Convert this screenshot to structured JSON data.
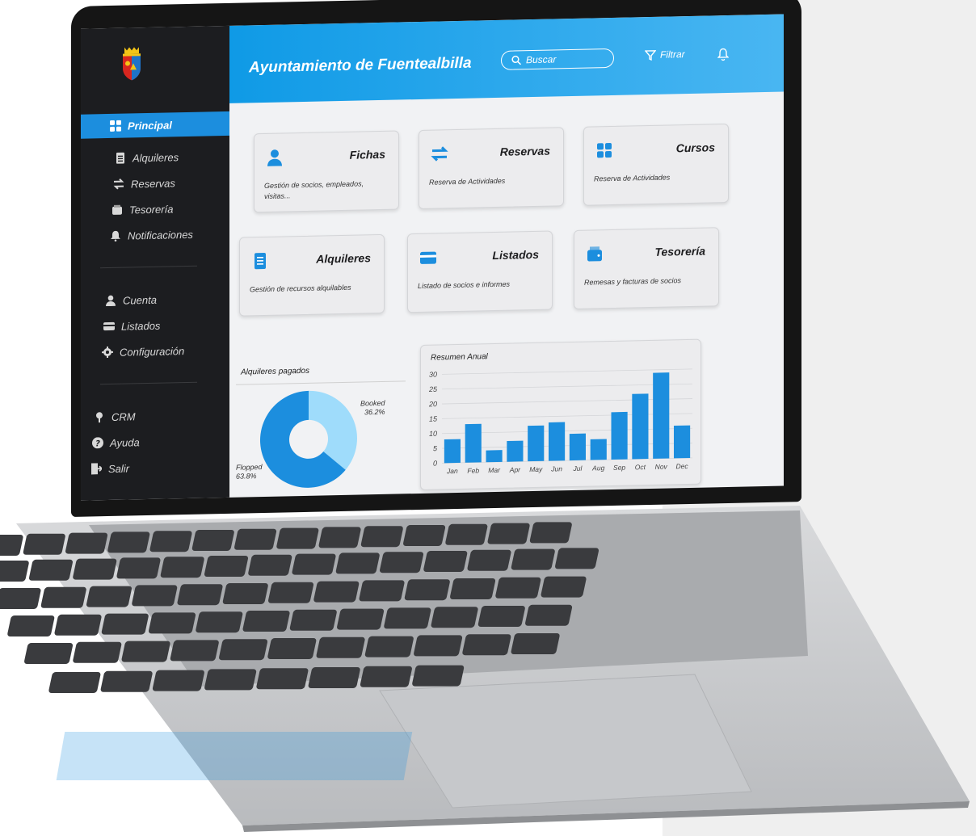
{
  "app": {
    "title": "Ayuntamiento de Fuentealbilla"
  },
  "header": {
    "search_placeholder": "Buscar",
    "filter_label": "Filtrar"
  },
  "sidebar": {
    "active": {
      "label": "Principal",
      "icon": "grid-icon"
    },
    "items": [
      {
        "label": "Alquileres",
        "icon": "document-icon"
      },
      {
        "label": "Reservas",
        "icon": "swap-icon"
      },
      {
        "label": "Tesorería",
        "icon": "wallet-icon"
      },
      {
        "label": "Notificaciones",
        "icon": "bell-icon"
      }
    ],
    "account_items": [
      {
        "label": "Cuenta",
        "icon": "user-icon"
      },
      {
        "label": "Listados",
        "icon": "card-icon"
      },
      {
        "label": "Configuración",
        "icon": "gear-icon"
      }
    ],
    "bottom_items": [
      {
        "label": "CRM",
        "icon": "crm-icon"
      },
      {
        "label": "Ayuda",
        "icon": "help-icon"
      },
      {
        "label": "Salir",
        "icon": "logout-icon"
      }
    ]
  },
  "cards": [
    {
      "title": "Fichas",
      "desc": "Gestión de socios, empleados, visitas...",
      "icon": "user-icon"
    },
    {
      "title": "Reservas",
      "desc": "Reserva de Actividades",
      "icon": "swap-icon"
    },
    {
      "title": "Cursos",
      "desc": "Reserva de Actividades",
      "icon": "grid-icon"
    },
    {
      "title": "Alquileres",
      "desc": "Gestión de recursos alquilables",
      "icon": "document-icon"
    },
    {
      "title": "Listados",
      "desc": "Listado de socios e informes",
      "icon": "card-icon"
    },
    {
      "title": "Tesorería",
      "desc": "Remesas y facturas de socios",
      "icon": "wallet-icon"
    }
  ],
  "colors": {
    "accent": "#1c8ede",
    "accent_light": "#9fdcfb",
    "sidebar_bg": "#1c1d20"
  },
  "chart_data": [
    {
      "type": "pie",
      "title": "Alquileres pagados",
      "slices": [
        {
          "label": "Booked",
          "value": 36.2,
          "display": "36.2%"
        },
        {
          "label": "Flopped",
          "value": 63.8,
          "display": "63.8%"
        }
      ]
    },
    {
      "type": "bar",
      "title": "Resumen Anual",
      "categories": [
        "Jan",
        "Feb",
        "Mar",
        "Apr",
        "May",
        "Jun",
        "Jul",
        "Aug",
        "Sep",
        "Oct",
        "Nov",
        "Dec"
      ],
      "values": [
        8,
        13,
        4,
        7,
        12,
        13,
        9,
        7,
        16,
        22,
        29,
        11
      ],
      "yticks": [
        "0",
        "5",
        "10",
        "15",
        "20",
        "25",
        "30"
      ],
      "ylim": [
        0,
        30
      ],
      "grid": true
    }
  ]
}
